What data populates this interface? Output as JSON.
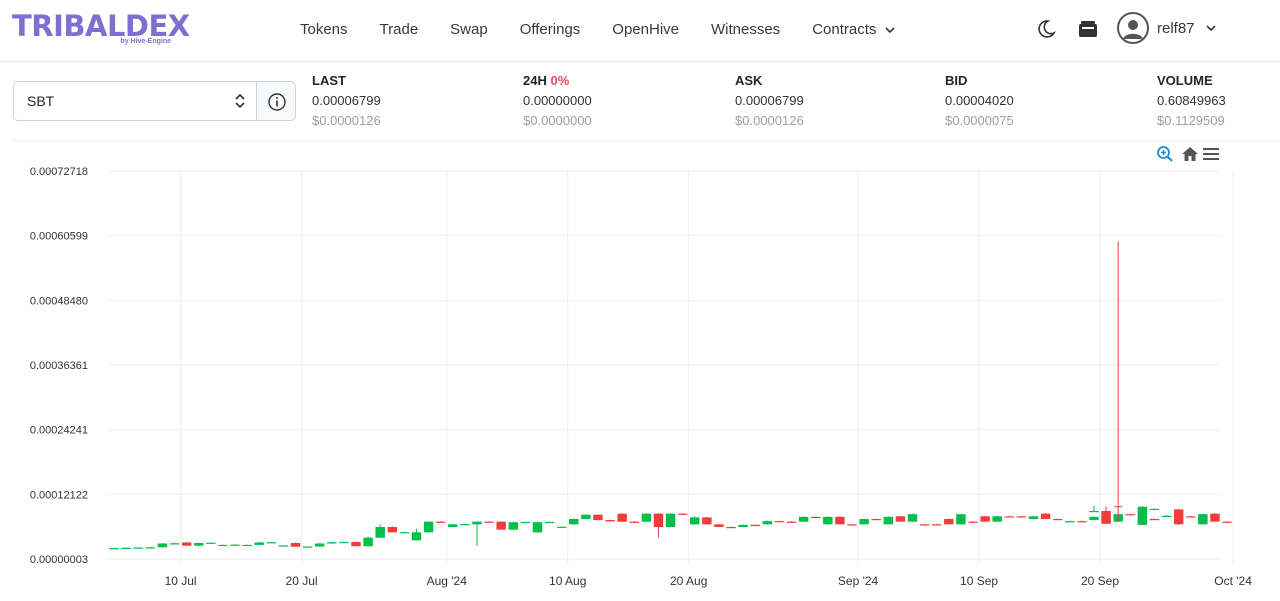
{
  "header": {
    "logo_text": "TRIBALDEX",
    "logo_sub": "by Hive-Engine",
    "nav": [
      {
        "label": "Tokens"
      },
      {
        "label": "Trade"
      },
      {
        "label": "Swap"
      },
      {
        "label": "Offerings"
      },
      {
        "label": "OpenHive"
      },
      {
        "label": "Witnesses"
      },
      {
        "label": "Contracts"
      }
    ],
    "username": "relf87"
  },
  "token_select": {
    "value": "SBT"
  },
  "stats": {
    "last": {
      "label": "LAST",
      "value": "0.00006799",
      "usd": "$0.0000126"
    },
    "change": {
      "label": "24H",
      "pct": "0%",
      "value": "0.00000000",
      "usd": "$0.0000000"
    },
    "ask": {
      "label": "ASK",
      "value": "0.00006799",
      "usd": "$0.0000126"
    },
    "bid": {
      "label": "BID",
      "value": "0.00004020",
      "usd": "$0.0000075"
    },
    "volume": {
      "label": "VOLUME",
      "value": "0.60849963",
      "usd": "$0.1129509"
    }
  },
  "colors": {
    "up": "#00c04b",
    "down": "#f23c3c",
    "accent": "#7e6fd1",
    "link": "#1d8ad8"
  },
  "chart_data": {
    "type": "candlestick",
    "y_ticks": [
      "0.00000003",
      "0.00012122",
      "0.00024241",
      "0.00036361",
      "0.00048480",
      "0.00060599",
      "0.00072718"
    ],
    "y_min": 3e-08,
    "y_max": 0.00072718,
    "x_ticks": [
      "10 Jul",
      "20 Jul",
      "Aug '24",
      "10 Aug",
      "20 Aug",
      "Sep '24",
      "10 Sep",
      "20 Sep",
      "Oct '24"
    ],
    "x_tick_days": [
      6,
      16,
      28,
      38,
      48,
      62,
      72,
      82,
      93
    ],
    "first_day": "4 Jul",
    "last_day": "4 Oct",
    "candles": [
      [
        2e-05,
        2.1e-05,
        1.95e-05,
        2.05e-05
      ],
      [
        2.05e-05,
        2.15e-05,
        2e-05,
        2.1e-05
      ],
      [
        2.1e-05,
        2.2e-05,
        2.05e-05,
        2.15e-05
      ],
      [
        2.15e-05,
        2.25e-05,
        2.1e-05,
        2.2e-05
      ],
      [
        2.2e-05,
        3e-05,
        2.15e-05,
        2.9e-05
      ],
      [
        2.9e-05,
        3.1e-05,
        2.8e-05,
        2.95e-05
      ],
      [
        3.1e-05,
        3.2e-05,
        2.5e-05,
        2.5e-05
      ],
      [
        2.5e-05,
        3.1e-05,
        2.45e-05,
        3e-05
      ],
      [
        3e-05,
        3.1e-05,
        2.9e-05,
        3.05e-05
      ],
      [
        2.6e-05,
        2.7e-05,
        2.5e-05,
        2.65e-05
      ],
      [
        2.65e-05,
        2.75e-05,
        2.55e-05,
        2.7e-05
      ],
      [
        2.6e-05,
        2.7e-05,
        2.55e-05,
        2.65e-05
      ],
      [
        2.65e-05,
        3.2e-05,
        2.6e-05,
        3.1e-05
      ],
      [
        3.1e-05,
        3.2e-05,
        3e-05,
        3.15e-05
      ],
      [
        2.5e-05,
        2.6e-05,
        2.45e-05,
        2.55e-05
      ],
      [
        3e-05,
        3.1e-05,
        2.3e-05,
        2.3e-05
      ],
      [
        2.3e-05,
        2.4e-05,
        2.25e-05,
        2.35e-05
      ],
      [
        2.35e-05,
        3e-05,
        2.3e-05,
        2.9e-05
      ],
      [
        2.9e-05,
        3.2e-05,
        2.85e-05,
        3.15e-05
      ],
      [
        3.15e-05,
        3.3e-05,
        3.1e-05,
        3.2e-05
      ],
      [
        3.2e-05,
        3.3e-05,
        2.4e-05,
        2.4e-05
      ],
      [
        2.4e-05,
        4.2e-05,
        2.35e-05,
        4e-05
      ],
      [
        4e-05,
        6.5e-05,
        3.95e-05,
        6e-05
      ],
      [
        6e-05,
        6.1e-05,
        5e-05,
        5e-05
      ],
      [
        5e-05,
        5.1e-05,
        4.9e-05,
        5.05e-05
      ],
      [
        3.5e-05,
        5.6e-05,
        3.45e-05,
        5e-05
      ],
      [
        5e-05,
        7.1e-05,
        4.95e-05,
        7e-05
      ],
      [
        7e-05,
        7.1e-05,
        6.9e-05,
        6.95e-05
      ],
      [
        6e-05,
        6.6e-05,
        5.95e-05,
        6.5e-05
      ],
      [
        6.5e-05,
        6.6e-05,
        6.45e-05,
        6.55e-05
      ],
      [
        6.5e-05,
        7.1e-05,
        2.5e-05,
        7e-05
      ],
      [
        7e-05,
        7.1e-05,
        6.9e-05,
        6.95e-05
      ],
      [
        7e-05,
        7.1e-05,
        5.5e-05,
        5.5e-05
      ],
      [
        5.5e-05,
        7e-05,
        5.45e-05,
        6.9e-05
      ],
      [
        6.9e-05,
        7e-05,
        6.8e-05,
        6.95e-05
      ],
      [
        5e-05,
        7e-05,
        4.95e-05,
        6.9e-05
      ],
      [
        6.9e-05,
        7e-05,
        6.8e-05,
        6.95e-05
      ],
      [
        6e-05,
        6.1e-05,
        5.9e-05,
        6.05e-05
      ],
      [
        6.5e-05,
        7.6e-05,
        6.45e-05,
        7.5e-05
      ],
      [
        7.5e-05,
        8.4e-05,
        7.45e-05,
        8.3e-05
      ],
      [
        8.3e-05,
        8.4e-05,
        7.2e-05,
        7.3e-05
      ],
      [
        7.3e-05,
        7.4e-05,
        7e-05,
        7.05e-05
      ],
      [
        8.5e-05,
        8.6e-05,
        7e-05,
        7e-05
      ],
      [
        7e-05,
        7.1e-05,
        6.9e-05,
        6.95e-05
      ],
      [
        7e-05,
        8.6e-05,
        6.95e-05,
        8.5e-05
      ],
      [
        8.5e-05,
        8.6e-05,
        4e-05,
        6e-05
      ],
      [
        6e-05,
        8.6e-05,
        5.95e-05,
        8.5e-05
      ],
      [
        8.5e-05,
        8.6e-05,
        8.4e-05,
        8.45e-05
      ],
      [
        6.5e-05,
        8e-05,
        6.45e-05,
        7.8e-05
      ],
      [
        7.8e-05,
        7.9e-05,
        6.5e-05,
        6.5e-05
      ],
      [
        6.5e-05,
        6.6e-05,
        6e-05,
        6e-05
      ],
      [
        6e-05,
        6.1e-05,
        5.9e-05,
        5.95e-05
      ],
      [
        6e-05,
        6.5e-05,
        5.95e-05,
        6.4e-05
      ],
      [
        6.4e-05,
        6.5e-05,
        6.3e-05,
        6.35e-05
      ],
      [
        6.5e-05,
        7.2e-05,
        6.45e-05,
        7.1e-05
      ],
      [
        7.1e-05,
        7.2e-05,
        7e-05,
        7.05e-05
      ],
      [
        7e-05,
        7.1e-05,
        6.9e-05,
        6.95e-05
      ],
      [
        7e-05,
        8e-05,
        6.95e-05,
        7.9e-05
      ],
      [
        7.9e-05,
        8e-05,
        7.8e-05,
        7.85e-05
      ],
      [
        6.5e-05,
        8e-05,
        6.45e-05,
        7.9e-05
      ],
      [
        7.9e-05,
        8e-05,
        6.5e-05,
        6.5e-05
      ],
      [
        6.5e-05,
        6.6e-05,
        6.4e-05,
        6.45e-05
      ],
      [
        6.5e-05,
        7.6e-05,
        6.45e-05,
        7.5e-05
      ],
      [
        7.5e-05,
        7.6e-05,
        7.4e-05,
        7.45e-05
      ],
      [
        6.5e-05,
        8e-05,
        6.45e-05,
        7.9e-05
      ],
      [
        8e-05,
        8.1e-05,
        7e-05,
        7e-05
      ],
      [
        7e-05,
        8.5e-05,
        6.95e-05,
        8.4e-05
      ],
      [
        6.5e-05,
        6.6e-05,
        6.4e-05,
        6.45e-05
      ],
      [
        6.5e-05,
        6.6e-05,
        6.4e-05,
        6.45e-05
      ],
      [
        7.5e-05,
        7.6e-05,
        6.5e-05,
        6.5e-05
      ],
      [
        6.5e-05,
        8.5e-05,
        6.45e-05,
        8.4e-05
      ],
      [
        7e-05,
        7.1e-05,
        6.9e-05,
        6.95e-05
      ],
      [
        8e-05,
        8.1e-05,
        7e-05,
        7e-05
      ],
      [
        7e-05,
        8.1e-05,
        6.95e-05,
        8e-05
      ],
      [
        8e-05,
        8.1e-05,
        7.9e-05,
        7.95e-05
      ],
      [
        8e-05,
        8.1e-05,
        7.9e-05,
        7.95e-05
      ],
      [
        7.5e-05,
        8.1e-05,
        7.45e-05,
        8e-05
      ],
      [
        8.5e-05,
        8.6e-05,
        7.5e-05,
        7.5e-05
      ],
      [
        7.5e-05,
        7.6e-05,
        7.4e-05,
        7.45e-05
      ],
      [
        7e-05,
        7.2e-05,
        6.95e-05,
        7.1e-05
      ],
      [
        7.1e-05,
        7.2e-05,
        7e-05,
        7.05e-05
      ],
      [
        9e-05,
        0.0001,
        8.95e-05,
        9e-05
      ],
      [
        9e-05,
        9.1e-05,
        7e-05,
        7e-05
      ],
      [
        7e-05,
        8.5e-05,
        6.95e-05,
        8.4e-05
      ],
      [
        8.4e-05,
        8.5e-05,
        8.3e-05,
        8.35e-05
      ],
      [
        8e-05,
        8.1e-05,
        7.9e-05,
        7.95e-05
      ],
      [
        7.5e-05,
        7.6e-05,
        7.4e-05,
        7.45e-05
      ],
      [
        8e-05,
        8.2e-05,
        7.95e-05,
        8.1e-05
      ],
      [
        8.1e-05,
        8.2e-05,
        8e-05,
        8.05e-05
      ],
      [
        8e-05,
        8.1e-05,
        7.9e-05,
        7.95e-05
      ],
      [
        7.5e-05,
        7.6e-05,
        7.4e-05,
        7.45e-05
      ],
      [
        8.5e-05,
        8.6e-05,
        7e-05,
        7e-05
      ],
      [
        7e-05,
        7.1e-05,
        6.9e-05,
        6.95e-05
      ]
    ]
  }
}
